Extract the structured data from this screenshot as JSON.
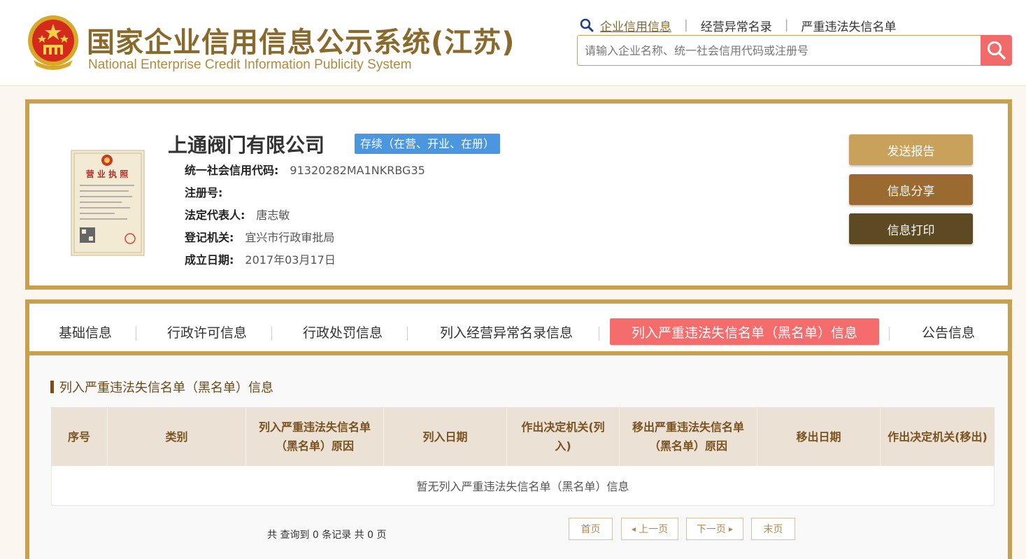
{
  "header": {
    "title_cn": "国家企业信用信息公示系统(江苏)",
    "title_en": "National Enterprise Credit Information Publicity System",
    "nav": {
      "enterprise_info": "企业信用信息",
      "abnormal_list": "经营异常名录",
      "serious_list": "严重违法失信名单"
    },
    "search": {
      "placeholder": "请输入企业名称、统一社会信用代码或注册号",
      "value": ""
    }
  },
  "company": {
    "name": "上通阀门有限公司",
    "status": "存续（在营、开业、在册）",
    "license_title": "营 业 执 照",
    "fields": [
      {
        "label": "统一社会信用代码:",
        "value": "91320282MA1NKRBG35"
      },
      {
        "label": "注册号:",
        "value": ""
      },
      {
        "label": "法定代表人:",
        "value": "唐志敏"
      },
      {
        "label": "登记机关:",
        "value": "宜兴市行政审批局"
      },
      {
        "label": "成立日期:",
        "value": "2017年03月17日"
      }
    ],
    "actions": {
      "send_report": "发送报告",
      "share": "信息分享",
      "print": "信息打印"
    }
  },
  "tabs": [
    {
      "label": "基础信息"
    },
    {
      "label": "行政许可信息"
    },
    {
      "label": "行政处罚信息"
    },
    {
      "label": "列入经营异常名录信息"
    },
    {
      "label": "列入严重违法失信名单（黑名单）信息"
    },
    {
      "label": "公告信息"
    }
  ],
  "section": {
    "title": "列入严重违法失信名单（黑名单）信息",
    "columns": [
      "序号",
      "类别",
      "列入严重违法失信名单（黑名单）原因",
      "列入日期",
      "作出决定机关(列入)",
      "移出严重违法失信名单（黑名单）原因",
      "移出日期",
      "作出决定机关(移出)"
    ],
    "empty_text": "暂无列入严重违法失信名单（黑名单）信息"
  },
  "pagination": {
    "summary": "共 查询到 0 条记录 共 0 页",
    "first": "首页",
    "prev": "上一页",
    "next": "下一页",
    "last": "末页"
  },
  "colors": {
    "gold": "#c9a14e",
    "active_tab": "#f46c6c",
    "status_badge": "#4a97e0",
    "search_button": "#f26b6b"
  }
}
